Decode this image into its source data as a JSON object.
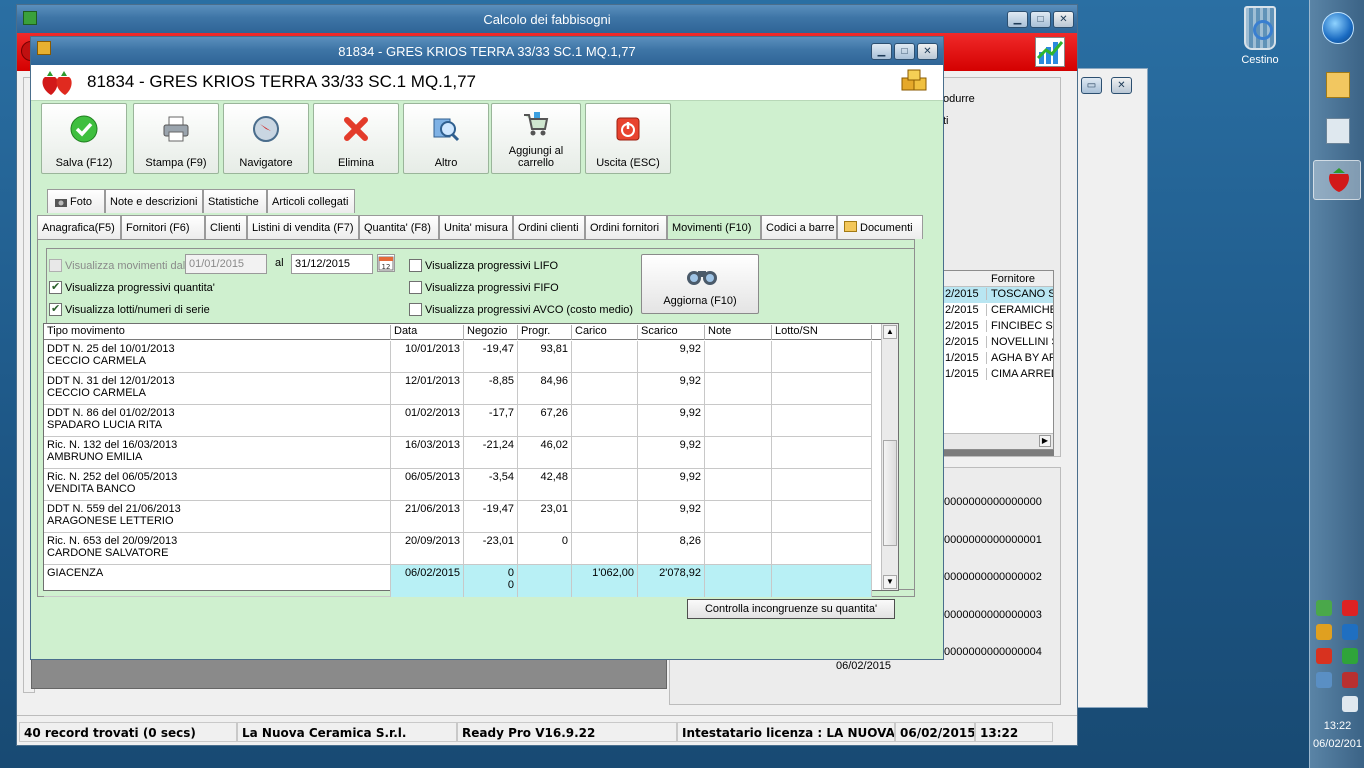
{
  "desktop": {
    "recycle_bin_label": "Cestino",
    "clock_time": "13:22",
    "clock_date": "06/02/201"
  },
  "main_window": {
    "title": "Calcolo dei fabbisogni",
    "bg_text_right_1": "odurre",
    "bg_text_right_2": "ti",
    "bg_grid": {
      "header": "Fornitore",
      "rows": [
        {
          "date": "2/2015",
          "name": "TOSCANO S."
        },
        {
          "date": "2/2015",
          "name": "CERAMICHE"
        },
        {
          "date": "2/2015",
          "name": "FINCIBEC SP"
        },
        {
          "date": "2/2015",
          "name": "NOVELLINI S"
        },
        {
          "date": "1/2015",
          "name": "AGHA BY AR"
        },
        {
          "date": "1/2015",
          "name": "CIMA ARRED"
        }
      ]
    },
    "codes": [
      "0000000000000000",
      "0000000000000001",
      "0000000000000002",
      "0000000000000003",
      "0000000000000004"
    ],
    "bg_date": "06/02/2015",
    "status": {
      "records": "40 record trovati (0 secs)",
      "company": "La Nuova Ceramica S.r.l.",
      "version": "Ready Pro V16.9.22",
      "license": "Intestatario licenza : LA NUOVA CERAM",
      "date": "06/02/2015",
      "time": "13:22"
    }
  },
  "item_window": {
    "title": "81834 - GRES KRIOS TERRA 33/33 SC.1 MQ.1,77",
    "header_name": "81834 - GRES KRIOS TERRA 33/33 SC.1 MQ.1,77",
    "toolbar": {
      "save": "Salva (F12)",
      "print": "Stampa (F9)",
      "navigator": "Navigatore",
      "delete": "Elimina",
      "other": "Altro",
      "cart_line1": "Aggiungi al",
      "cart_line2": "carrello",
      "exit": "Uscita (ESC)"
    },
    "tabs_top": [
      "Foto",
      "Note e descrizioni",
      "Statistiche",
      "Articoli collegati"
    ],
    "tabs_bottom": [
      "Anagrafica(F5)",
      "Fornitori (F6)",
      "Clienti",
      "Listini di vendita (F7)",
      "Quantita' (F8)",
      "Unita' misura",
      "Ordini clienti",
      "Ordini fornitori",
      "Movimenti (F10)",
      "Codici a barre",
      "Documenti"
    ],
    "filters": {
      "show_from_label": "Visualizza movimenti dal",
      "date_from": "01/01/2015",
      "al_label": "al",
      "date_to": "31/12/2015",
      "progressive_qty": "Visualizza progressivi quantita'",
      "lots_serials": "Visualizza lotti/numeri di serie",
      "lifo": "Visualizza progressivi LIFO",
      "fifo": "Visualizza progressivi FIFO",
      "avco": "Visualizza progressivi AVCO (costo medio)",
      "refresh": "Aggiorna (F10)"
    },
    "grid": {
      "headers": [
        "Tipo movimento",
        "Data",
        "Negozio",
        "Progr.",
        "Carico",
        "Scarico",
        "Note",
        "Lotto/SN"
      ],
      "rows": [
        {
          "doc": "DDT N. 25 del 10/01/2013",
          "party": "CECCIO CARMELA",
          "date": "10/01/2013",
          "negozio": "-19,47",
          "progr": "93,81",
          "carico": "",
          "scarico": "9,92"
        },
        {
          "doc": "DDT N. 31 del 12/01/2013",
          "party": "CECCIO CARMELA",
          "date": "12/01/2013",
          "negozio": "-8,85",
          "progr": "84,96",
          "carico": "",
          "scarico": "9,92"
        },
        {
          "doc": "DDT N. 86 del 01/02/2013",
          "party": "SPADARO LUCIA RITA",
          "date": "01/02/2013",
          "negozio": "-17,7",
          "progr": "67,26",
          "carico": "",
          "scarico": "9,92"
        },
        {
          "doc": "Ric. N. 132 del 16/03/2013",
          "party": "AMBRUNO EMILIA",
          "date": "16/03/2013",
          "negozio": "-21,24",
          "progr": "46,02",
          "carico": "",
          "scarico": "9,92"
        },
        {
          "doc": "Ric. N. 252 del 06/05/2013",
          "party": "VENDITA BANCO",
          "date": "06/05/2013",
          "negozio": "-3,54",
          "progr": "42,48",
          "carico": "",
          "scarico": "9,92"
        },
        {
          "doc": "DDT N. 559 del 21/06/2013",
          "party": "ARAGONESE LETTERIO",
          "date": "21/06/2013",
          "negozio": "-19,47",
          "progr": "23,01",
          "carico": "",
          "scarico": "9,92"
        },
        {
          "doc": "Ric. N. 653 del 20/09/2013",
          "party": "CARDONE SALVATORE",
          "date": "20/09/2013",
          "negozio": "-23,01",
          "progr": "0",
          "carico": "",
          "scarico": "8,26"
        }
      ],
      "total": {
        "label": "GIACENZA",
        "date": "06/02/2015",
        "negozio_1": "0",
        "negozio_2": "0",
        "carico": "1'062,00",
        "scarico": "2'078,92"
      }
    },
    "check_button": "Controlla incongruenze su quantita'"
  }
}
